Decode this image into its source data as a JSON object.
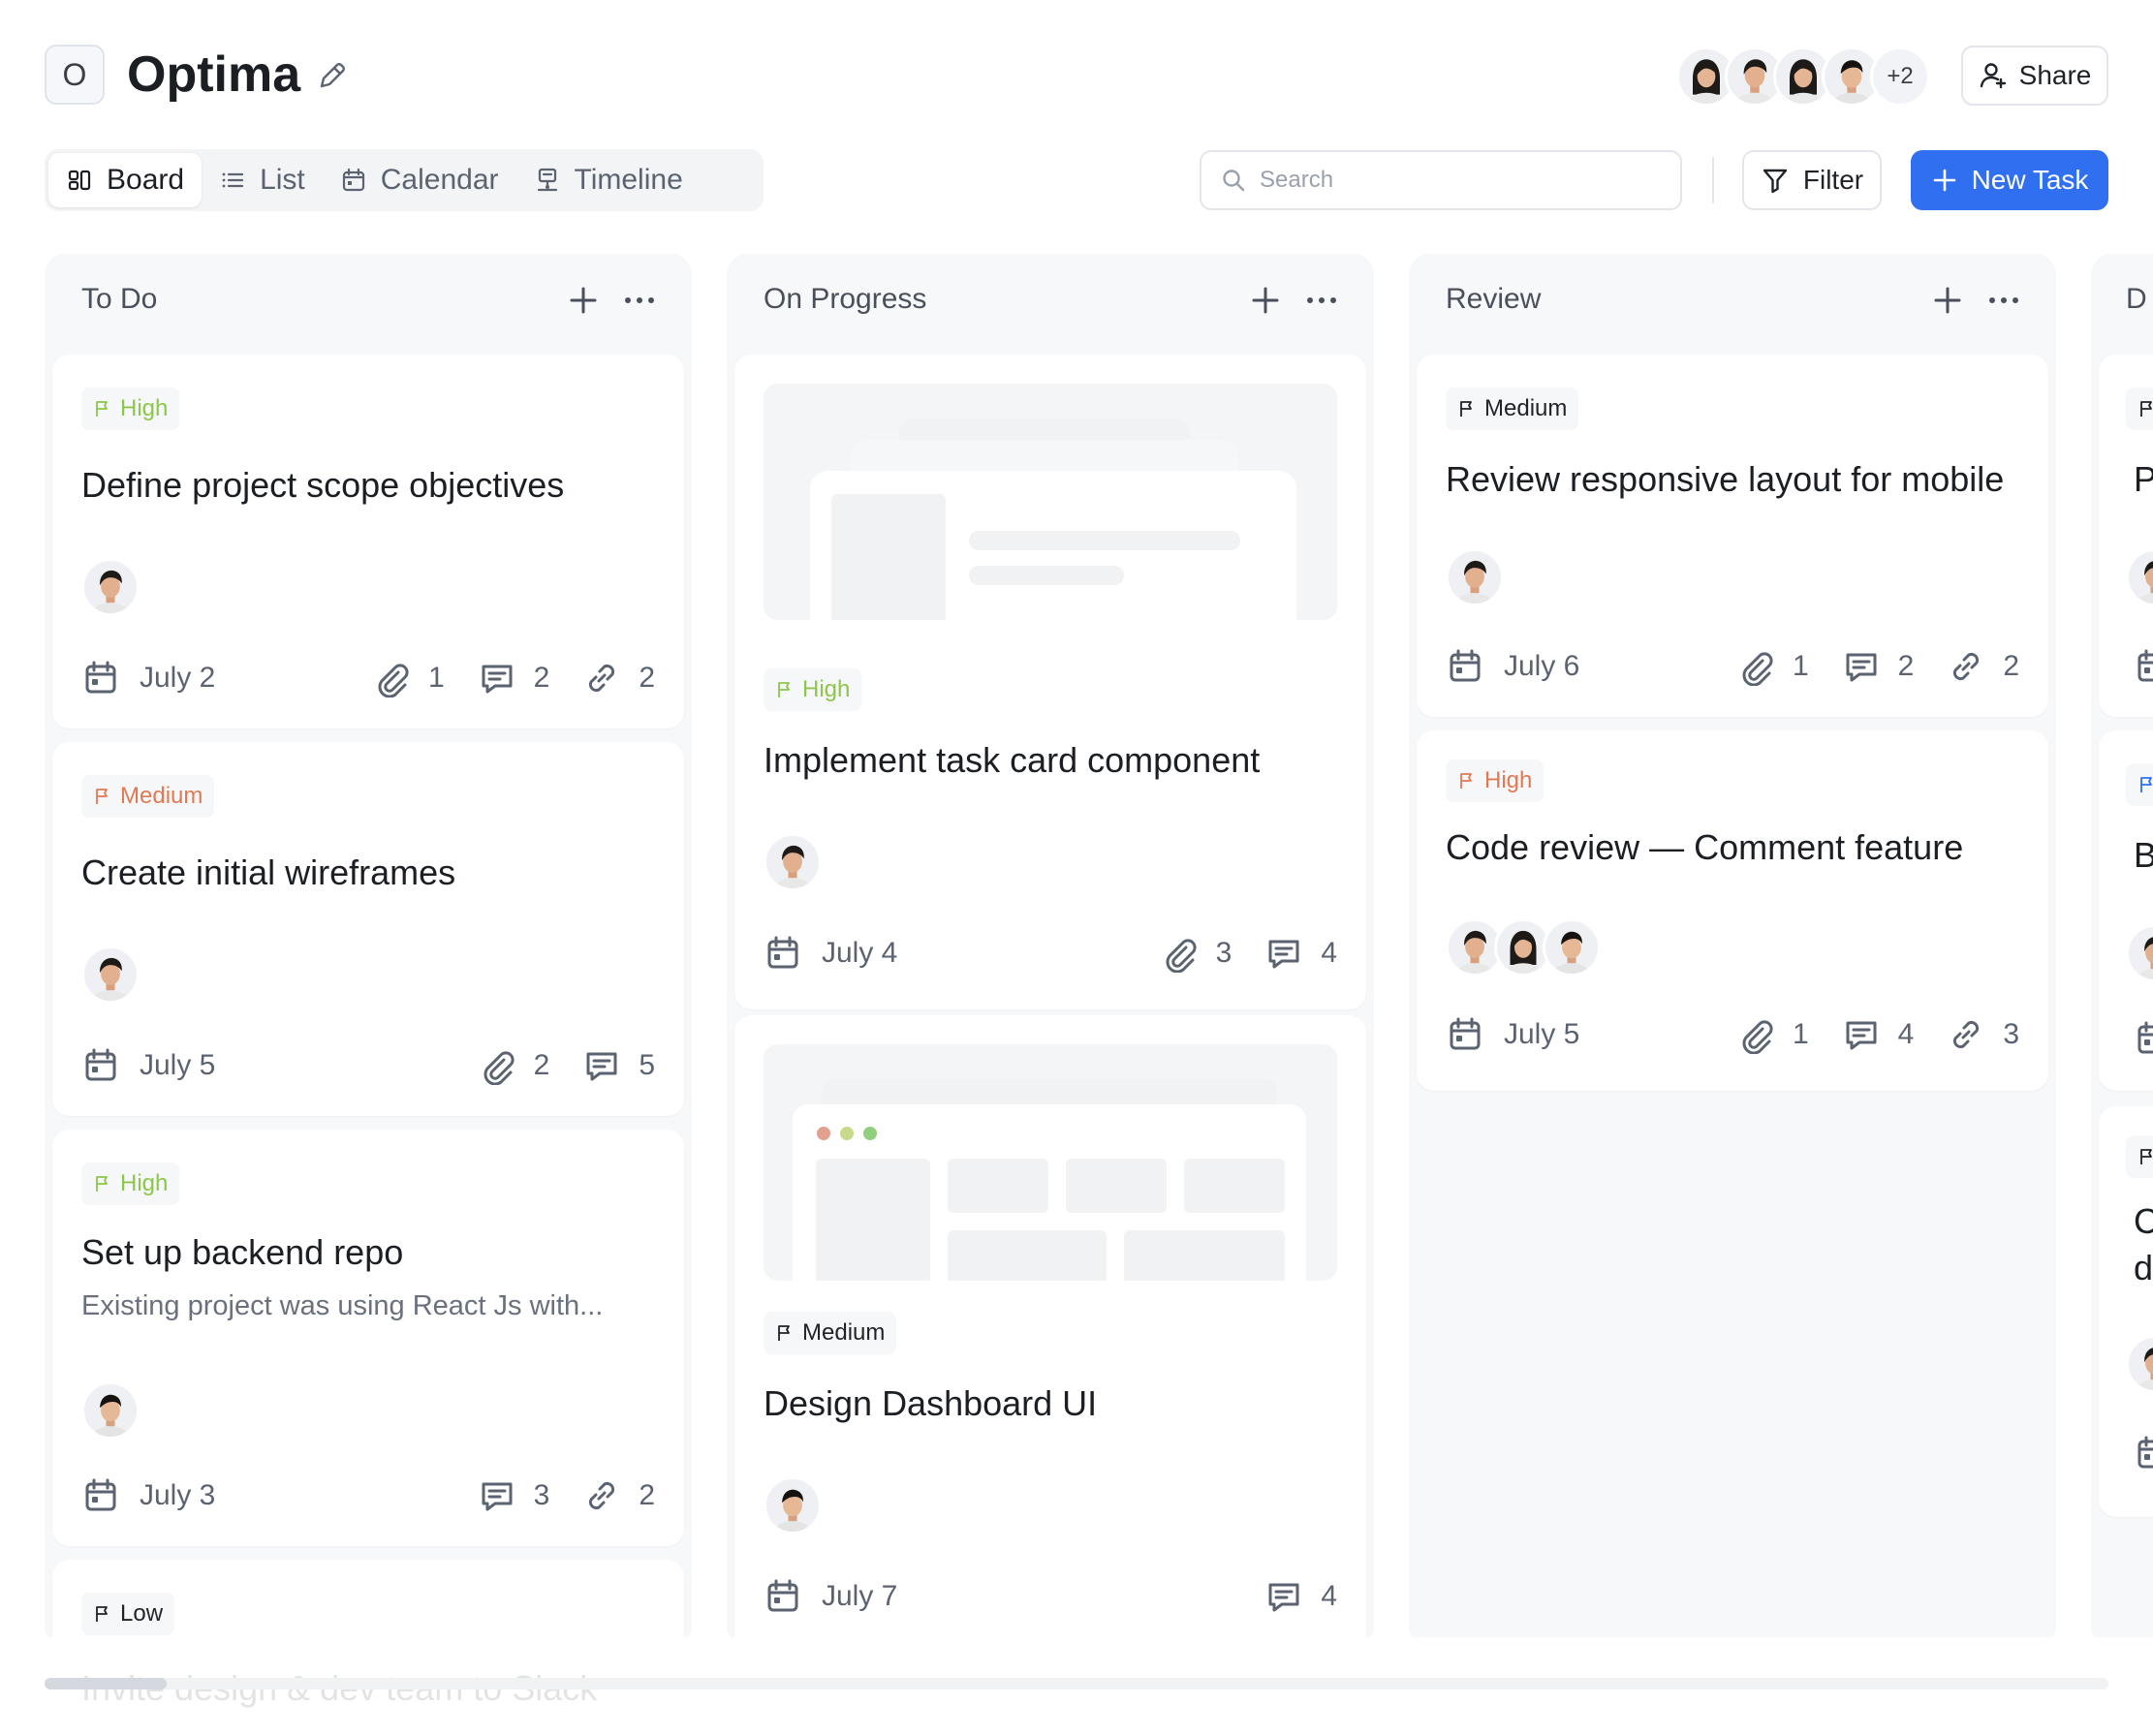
{
  "project": {
    "badge": "O",
    "title": "Optima"
  },
  "collaborators": {
    "more": "+2"
  },
  "actions": {
    "share": "Share",
    "filter": "Filter",
    "new_task": "New Task"
  },
  "search": {
    "placeholder": "Search"
  },
  "views": [
    {
      "label": "Board",
      "active": true,
      "icon": "board-icon"
    },
    {
      "label": "List",
      "active": false,
      "icon": "list-icon"
    },
    {
      "label": "Calendar",
      "active": false,
      "icon": "calendar-icon"
    },
    {
      "label": "Timeline",
      "active": false,
      "icon": "timeline-icon"
    }
  ],
  "columns": [
    {
      "title": "To Do",
      "cards": [
        {
          "priority": "High",
          "title": "Define project scope objectives",
          "date": "July 2",
          "attachments": "1",
          "comments": "2",
          "links": "2"
        },
        {
          "priority": "Medium",
          "title": "Create initial wireframes",
          "date": "July 5",
          "attachments": "2",
          "comments": "5"
        },
        {
          "priority": "High",
          "title": "Set up backend repo",
          "description": "Existing project was using React Js with...",
          "date": "July 3",
          "comments": "3",
          "links": "2"
        },
        {
          "priority": "Low",
          "title": "Invite design & dev team to Slack"
        }
      ]
    },
    {
      "title": "On Progress",
      "cards": [
        {
          "priority": "High",
          "title": "Implement task card component",
          "date": "July 4",
          "attachments": "3",
          "comments": "4"
        },
        {
          "priority": "Medium",
          "title": "Design Dashboard UI",
          "date": "July 7",
          "comments": "4"
        }
      ]
    },
    {
      "title": "Review",
      "cards": [
        {
          "priority": "Medium",
          "title": "Review responsive layout for mobile",
          "date": "July 6",
          "attachments": "1",
          "comments": "2",
          "links": "2"
        },
        {
          "priority": "High",
          "title": "Code review — Comment feature",
          "date": "July 5",
          "attachments": "1",
          "comments": "4",
          "links": "3"
        }
      ]
    },
    {
      "title": "D",
      "cards": [
        {
          "title": "Pr"
        },
        {
          "title": "Br"
        },
        {
          "title": "C",
          "title_line2": "de"
        }
      ]
    }
  ],
  "colors": {
    "accent": "#2f6ff0",
    "high": "#8dc64a",
    "medium": "#e07a55",
    "text": "#1b1f24",
    "muted": "#5b6270"
  }
}
